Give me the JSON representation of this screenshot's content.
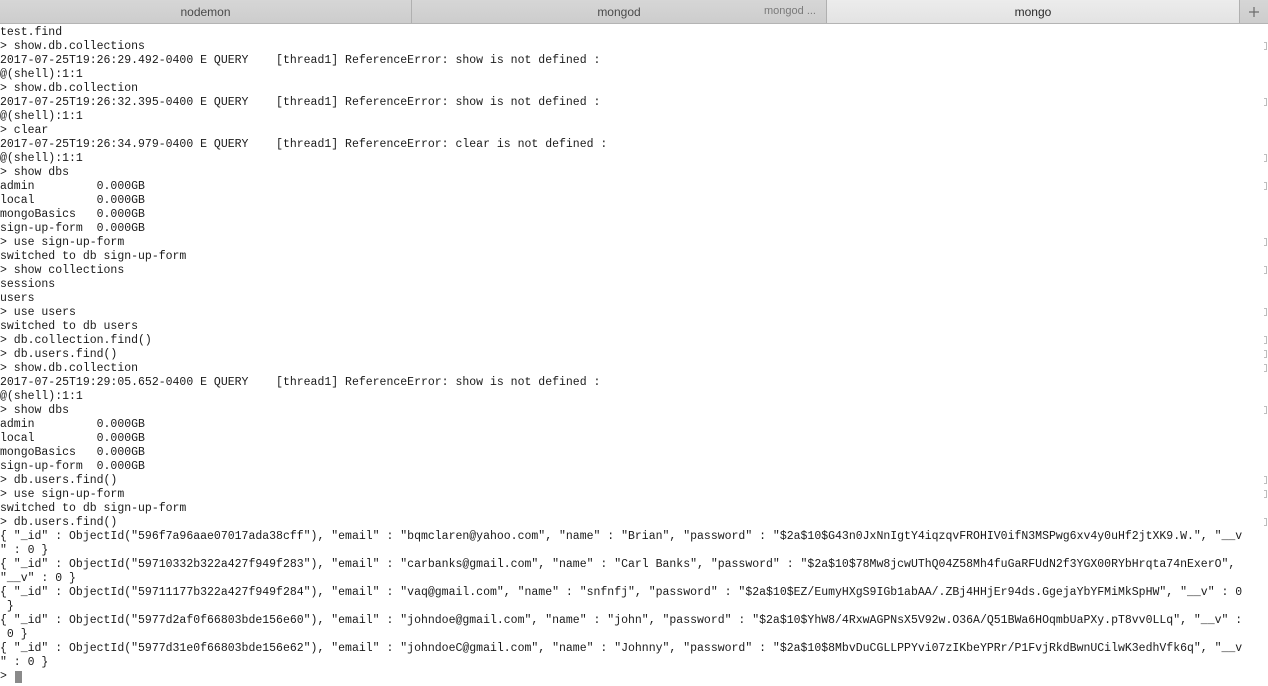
{
  "tabs": [
    {
      "label": "nodemon",
      "sublabel": ""
    },
    {
      "label": "mongod",
      "sublabel": "mongod ..."
    },
    {
      "label": "mongo",
      "sublabel": ""
    }
  ],
  "new_tab_icon": "plus-icon",
  "terminal": {
    "lines": [
      "test.find",
      "> show.db.collections",
      "2017-07-25T19:26:29.492-0400 E QUERY    [thread1] ReferenceError: show is not defined :",
      "@(shell):1:1",
      "> show.db.collection",
      "2017-07-25T19:26:32.395-0400 E QUERY    [thread1] ReferenceError: show is not defined :",
      "@(shell):1:1",
      "> clear",
      "2017-07-25T19:26:34.979-0400 E QUERY    [thread1] ReferenceError: clear is not defined :",
      "@(shell):1:1",
      "> show dbs",
      "admin         0.000GB",
      "local         0.000GB",
      "mongoBasics   0.000GB",
      "sign-up-form  0.000GB",
      "> use sign-up-form",
      "switched to db sign-up-form",
      "> show collections",
      "sessions",
      "users",
      "> use users",
      "switched to db users",
      "> db.collection.find()",
      "> db.users.find()",
      "> show.db.collection",
      "2017-07-25T19:29:05.652-0400 E QUERY    [thread1] ReferenceError: show is not defined :",
      "@(shell):1:1",
      "> show dbs",
      "admin         0.000GB",
      "local         0.000GB",
      "mongoBasics   0.000GB",
      "sign-up-form  0.000GB",
      "> db.users.find()",
      "> use sign-up-form",
      "switched to db sign-up-form",
      "> db.users.find()",
      "{ \"_id\" : ObjectId(\"596f7a96aae07017ada38cff\"), \"email\" : \"bqmclaren@yahoo.com\", \"name\" : \"Brian\", \"password\" : \"$2a$10$G43n0JxNnIgtY4iqzqvFROHIV0ifN3MSPwg6xv4y0uHf2jtXK9.W.\", \"__v",
      "\" : 0 }",
      "{ \"_id\" : ObjectId(\"59710332b322a427f949f283\"), \"email\" : \"carbanks@gmail.com\", \"name\" : \"Carl Banks\", \"password\" : \"$2a$10$78Mw8jcwUThQ04Z58Mh4fuGaRFUdN2f3YGX00RYbHrqta74nExerO\",",
      "\"__v\" : 0 }",
      "{ \"_id\" : ObjectId(\"59711177b322a427f949f284\"), \"email\" : \"vaq@gmail.com\", \"name\" : \"snfnfj\", \"password\" : \"$2a$10$EZ/EumyHXgS9IGb1abAA/.ZBj4HHjEr94ds.GgejaYbYFMiMkSpHW\", \"__v\" : 0",
      " }",
      "{ \"_id\" : ObjectId(\"5977d2af0f66803bde156e60\"), \"email\" : \"johndoe@gmail.com\", \"name\" : \"john\", \"password\" : \"$2a$10$YhW8/4RxwAGPNsX5V92w.O36A/Q51BWa6HOqmbUaPXy.pT8vv0LLq\", \"__v\" :",
      " 0 }",
      "{ \"_id\" : ObjectId(\"5977d31e0f66803bde156e62\"), \"email\" : \"johndoeC@gmail.com\", \"name\" : \"Johnny\", \"password\" : \"$2a$10$8MbvDuCGLLPPYvi07zIKbeYPRr/P1FvjRkdBwnUCilwK3edhVfk6q\", \"__v",
      "\" : 0 }"
    ],
    "prompt": "> "
  }
}
